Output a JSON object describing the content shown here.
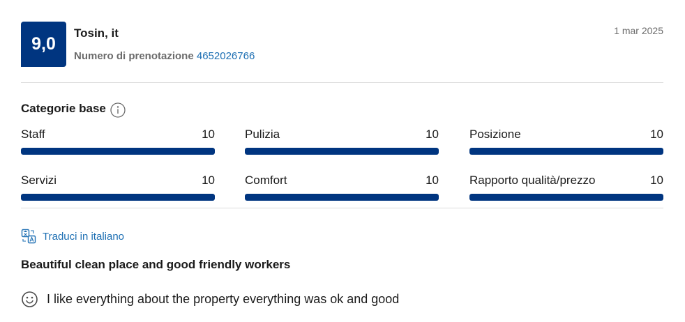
{
  "review": {
    "score": "9,0",
    "reviewer": "Tosin, it",
    "booking_label": "Numero di prenotazione",
    "booking_number": "4652026766",
    "date": "1 mar 2025"
  },
  "categories": {
    "title": "Categorie base",
    "info_icon": "info-icon",
    "items": [
      {
        "label": "Staff",
        "value": "10",
        "fill": 1.0
      },
      {
        "label": "Pulizia",
        "value": "10",
        "fill": 1.0
      },
      {
        "label": "Posizione",
        "value": "10",
        "fill": 1.0
      },
      {
        "label": "Servizi",
        "value": "10",
        "fill": 1.0
      },
      {
        "label": "Comfort",
        "value": "10",
        "fill": 1.0
      },
      {
        "label": "Rapporto qualità/prezzo",
        "value": "10",
        "fill": 1.0
      }
    ]
  },
  "translate": {
    "label": "Traduci in italiano",
    "icon": "translate-icon"
  },
  "content": {
    "title": "Beautiful clean place and good friendly workers",
    "positive_icon": "smile-icon",
    "positive_text": "I like everything about the property everything was ok and good"
  },
  "colors": {
    "brand": "#003580",
    "link": "#1d6fb3"
  }
}
